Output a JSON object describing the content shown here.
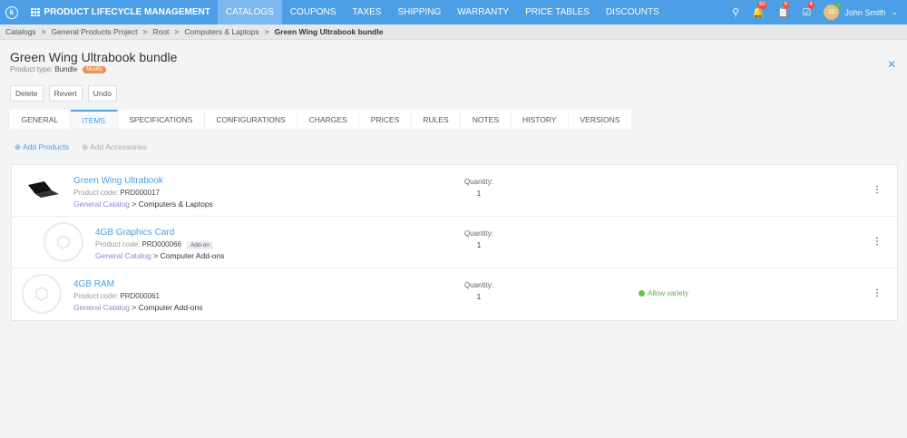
{
  "nav": {
    "app_title": "PRODUCT LIFECYCLE MANAGEMENT",
    "items": [
      "CATALOGS",
      "COUPONS",
      "TAXES",
      "SHIPPING",
      "WARRANTY",
      "PRICE TABLES",
      "DISCOUNTS"
    ],
    "active": "CATALOGS",
    "notifications": "60",
    "tasks": "6",
    "approvals": "4",
    "user_initials": "JS",
    "user_name": "John Smith"
  },
  "breadcrumb": [
    "Catalogs",
    "General Products Project",
    "Root",
    "Computers & Laptops",
    "Green Wing Ultrabook bundle"
  ],
  "header": {
    "title": "Green Wing Ultrabook bundle",
    "product_type_label": "Product type:",
    "product_type": "Bundle",
    "status": "Modify"
  },
  "actions": {
    "delete": "Delete",
    "revert": "Revert",
    "undo": "Undo"
  },
  "tabs": [
    "GENERAL",
    "ITEMS",
    "SPECIFICATIONS",
    "CONFIGURATIONS",
    "CHARGES",
    "PRICES",
    "RULES",
    "NOTES",
    "HISTORY",
    "VERSIONS"
  ],
  "item_actions": {
    "add_products": "Add Products",
    "add_accessories": "Add Accessories"
  },
  "items": [
    {
      "name": "Green Wing Ultrabook",
      "code_label": "Product code:",
      "code": "PRD000017",
      "catalog": "General Catalog",
      "category": "Computers & Laptops",
      "qty_label": "Quantity:",
      "qty": "1"
    },
    {
      "name": "4GB Graphics Card",
      "code_label": "Product code:",
      "code": "PRD000066",
      "badge": "Add-on",
      "catalog": "General Catalog",
      "category": "Computer Add-ons",
      "qty_label": "Quantity:",
      "qty": "1"
    },
    {
      "name": "4GB RAM",
      "code_label": "Product code:",
      "code": "PRD000061",
      "catalog": "General Catalog",
      "category": "Computer Add-ons",
      "qty_label": "Quantity:",
      "qty": "1",
      "note": "Allow variety"
    }
  ]
}
